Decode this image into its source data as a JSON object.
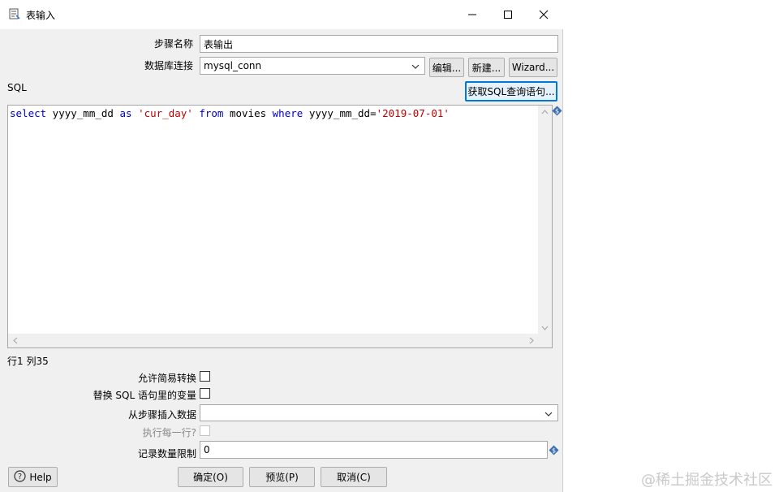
{
  "window": {
    "title": "表输入"
  },
  "form": {
    "step_name_label": "步骤名称",
    "step_name_value": "表输出",
    "db_conn_label": "数据库连接",
    "db_conn_value": "mysql_conn",
    "edit_button": "编辑...",
    "new_button": "新建...",
    "wizard_button": "Wizard...",
    "sql_label": "SQL",
    "get_sql_button": "获取SQL查询语句...",
    "sql": {
      "t1": "select",
      "t2": " yyyy_mm_dd ",
      "t3": "as",
      "t4": " ",
      "t5": "'cur_day'",
      "t6": " ",
      "t7": "from",
      "t8": " movies ",
      "t9": "where",
      "t10": " yyyy_mm_dd=",
      "t11": "'2019-07-01'"
    },
    "cursor_position": "行1 列35",
    "allow_lazy_label": "允许简易转换",
    "replace_vars_label": "替换 SQL 语句里的变量",
    "insert_from_step_label": "从步骤插入数据",
    "insert_from_step_value": "",
    "execute_each_row_label": "执行每一行?",
    "limit_label": "记录数量限制",
    "limit_value": "0"
  },
  "footer": {
    "help_button": "Help",
    "ok_button": "确定(O)",
    "preview_button": "预览(P)",
    "cancel_button": "取消(C)"
  },
  "watermark": "@稀土掘金技术社区",
  "colors": {
    "keyword": "#0000c0",
    "string": "#c00000",
    "focus": "#0078d7"
  },
  "icons": {
    "dialog": "table-input-icon",
    "variable": "variable-dollar-icon",
    "help": "help-icon"
  }
}
